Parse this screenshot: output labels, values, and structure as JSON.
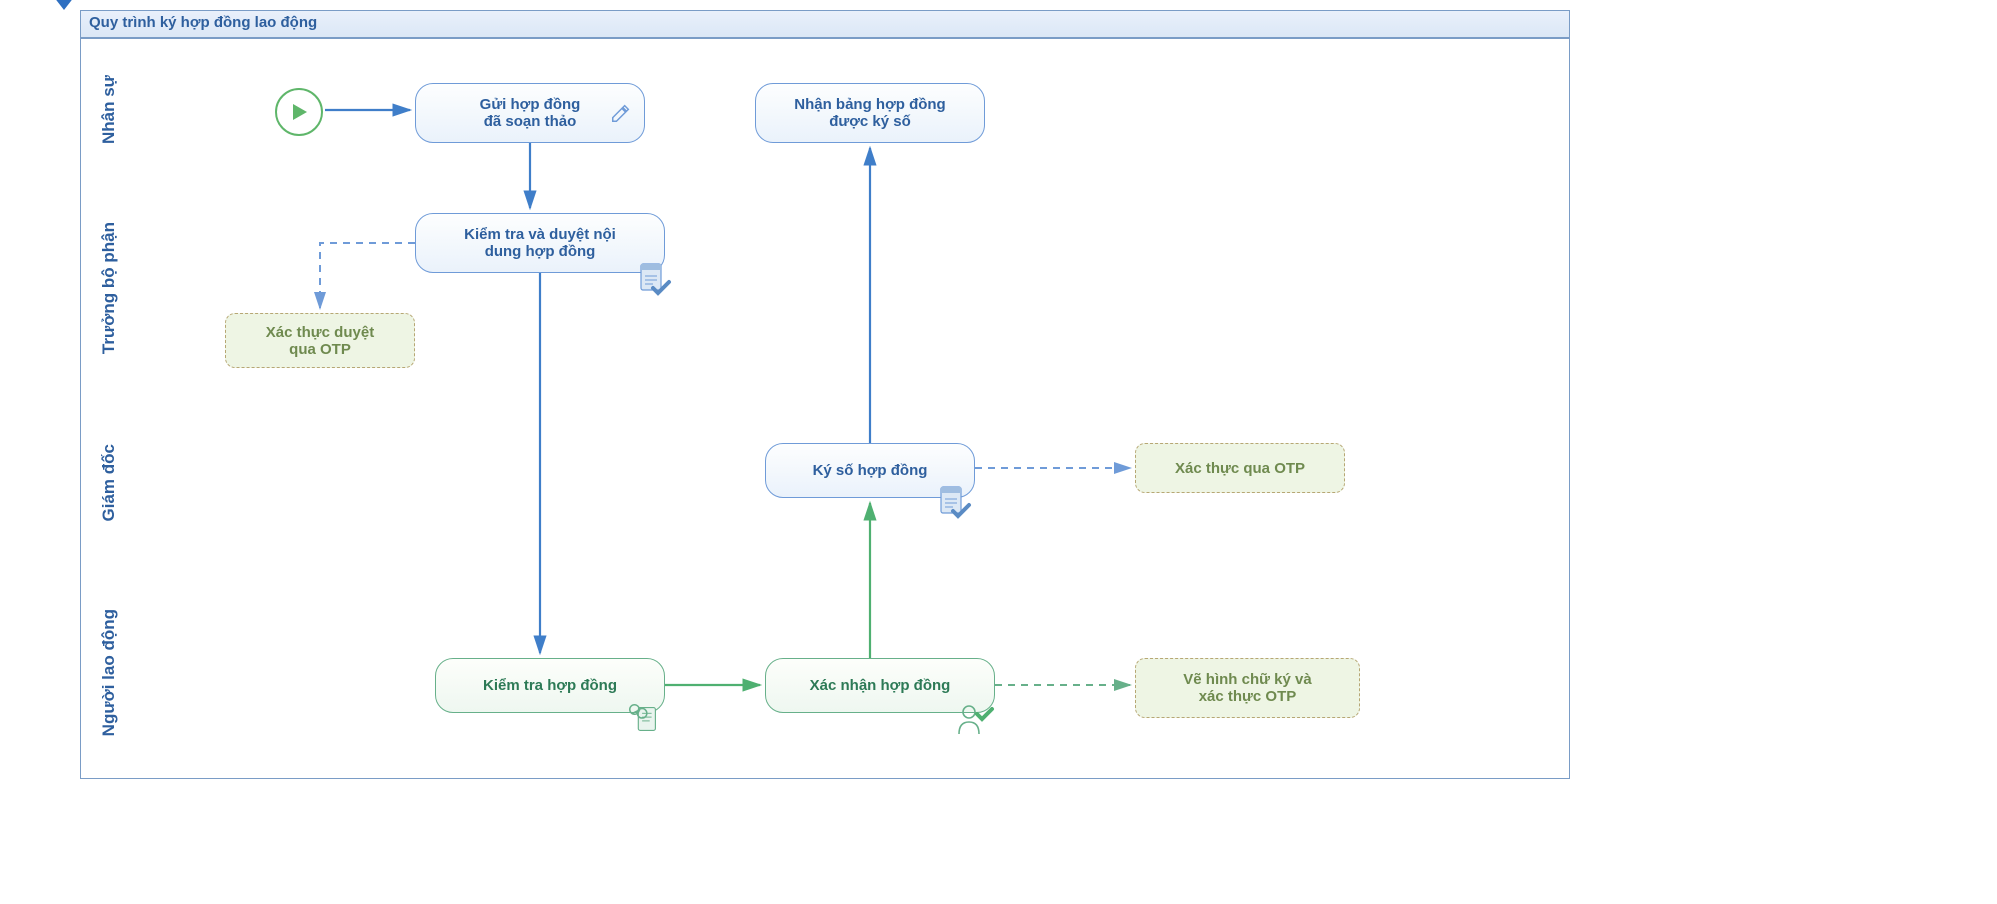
{
  "title": "Quy trình ký hợp đồng lao động",
  "lanes": {
    "l0": "Nhân sự",
    "l1": "Trưởng bộ phận",
    "l2": "Giám đốc",
    "l3": "Người lao động"
  },
  "nodes": {
    "n1": "Gửi hợp đồng\nđã soạn thảo",
    "n2": "Nhận bảng hợp đồng\nđược ký số",
    "n3": "Kiểm tra và duyệt nội\ndung hợp đồng",
    "n4": "Ký số hợp đồng",
    "n5": "Kiểm tra hợp đồng",
    "n6": "Xác nhận hợp đồng"
  },
  "notes": {
    "a1": "Xác thực duyệt\nqua OTP",
    "a2": "Xác thực qua OTP",
    "a3": "Vẽ hình chữ ký và\nxác thực OTP"
  },
  "icons": {
    "start": "play-icon",
    "pencil": "pencil-icon",
    "docCheck": "document-check-icon",
    "search": "search-doc-icon",
    "person": "person-check-icon"
  },
  "colors": {
    "blue": "#3f7ec9",
    "green": "#4fb071",
    "noteBorder": "#b7a774"
  }
}
